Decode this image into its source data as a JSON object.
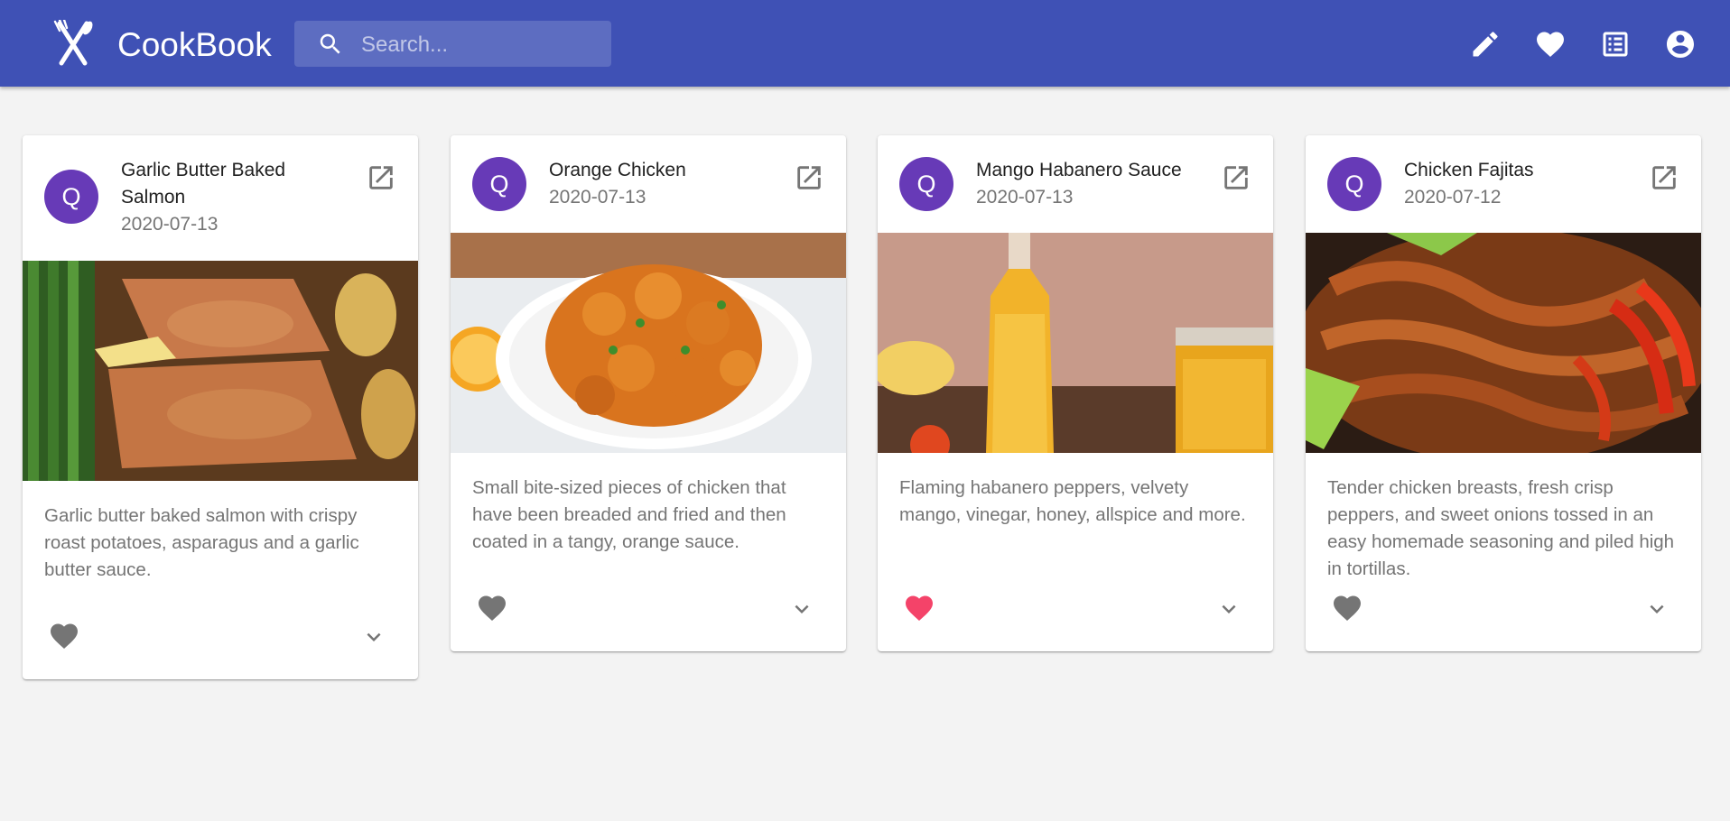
{
  "app": {
    "title": "CookBook",
    "search_placeholder": "Search...",
    "search_value": "",
    "colors": {
      "primary": "#3f51b5",
      "avatar": "#673ab7",
      "favorite": "#f44369",
      "icon_gray": "#757575"
    },
    "actions": [
      {
        "icon": "pencil-icon"
      },
      {
        "icon": "heart-icon"
      },
      {
        "icon": "list-icon"
      },
      {
        "icon": "account-circle-icon"
      }
    ]
  },
  "recipes": [
    {
      "avatar": "Q",
      "title": "Garlic Butter Baked Salmon",
      "date": "2020-07-13",
      "description": "Garlic butter baked salmon with crispy roast potatoes, asparagus and a garlic butter sauce.",
      "favorite": false
    },
    {
      "avatar": "Q",
      "title": "Orange Chicken",
      "date": "2020-07-13",
      "description": "Small bite-sized pieces of chicken that have been breaded and fried and then coated in a tangy, orange sauce.",
      "favorite": false
    },
    {
      "avatar": "Q",
      "title": "Mango Habanero Sauce",
      "date": "2020-07-13",
      "description": "Flaming habanero peppers, velvety mango, vinegar, honey, allspice and more.",
      "favorite": true
    },
    {
      "avatar": "Q",
      "title": "Chicken Fajitas",
      "date": "2020-07-12",
      "description": "Tender chicken breasts, fresh crisp peppers, and sweet onions tossed in an easy homemade seasoning and piled high in tortillas.",
      "favorite": false
    }
  ]
}
